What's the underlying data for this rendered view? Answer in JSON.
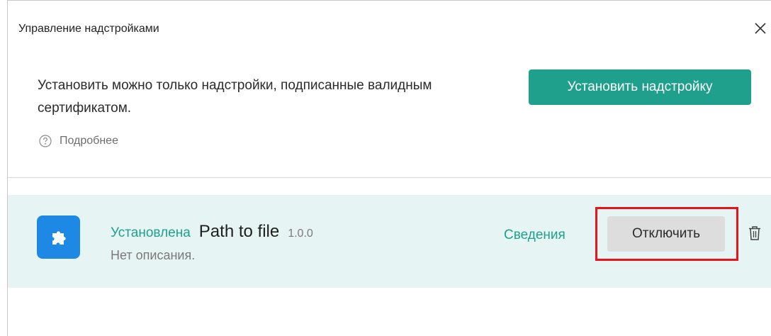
{
  "dialog": {
    "title": "Управление надстройками",
    "close_icon": "close-icon"
  },
  "info": {
    "text": "Установить можно только надстройки, подписанные валидным сертификатом.",
    "install_button_label": "Установить надстройку",
    "more_icon": "help-circle-icon",
    "more_label": "Подробнее"
  },
  "addon": {
    "icon": "puzzle-icon",
    "status": "Установлена",
    "name": "Path to file",
    "version": "1.0.0",
    "description": "Нет описания.",
    "details_label": "Сведения",
    "disable_label": "Отключить",
    "delete_icon": "trash-icon"
  },
  "colors": {
    "accent": "#1fa08d",
    "row_background": "#e6f4f3",
    "addon_icon_background": "#1e88e5",
    "highlight": "#e8141b",
    "secondary_button": "#dddddd"
  }
}
